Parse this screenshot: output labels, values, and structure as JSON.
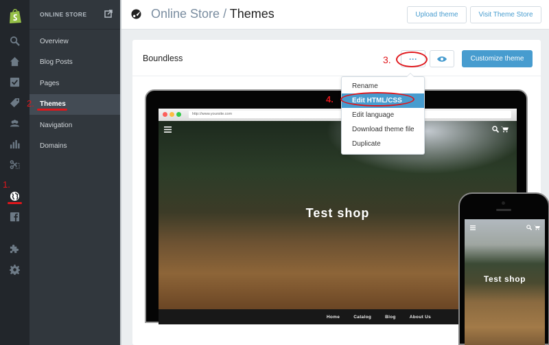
{
  "rail": {
    "icons": [
      "shopify-logo-icon",
      "search-icon",
      "home-icon",
      "orders-icon",
      "tag-icon",
      "customers-icon",
      "reports-icon",
      "discounts-icon",
      "online-store-icon",
      "facebook-icon",
      "apps-icon",
      "settings-icon"
    ],
    "brand_color": "#95bf47"
  },
  "subnav": {
    "header": "ONLINE STORE",
    "items": [
      {
        "label": "Overview"
      },
      {
        "label": "Blog Posts"
      },
      {
        "label": "Pages"
      },
      {
        "label": "Themes",
        "active": true
      },
      {
        "label": "Navigation"
      },
      {
        "label": "Domains"
      }
    ]
  },
  "header": {
    "breadcrumb": "Online Store",
    "separator": "/",
    "title": "Themes",
    "upload_label": "Upload theme",
    "visit_label": "Visit Theme Store"
  },
  "theme_card": {
    "name": "Boundless",
    "more_label": "···",
    "customize_label": "Customize theme",
    "accent": "#479ccf"
  },
  "dropdown": {
    "items": [
      {
        "label": "Rename"
      },
      {
        "label": "Edit HTML/CSS",
        "active": true
      },
      {
        "label": "Edit language"
      },
      {
        "label": "Download theme file"
      },
      {
        "label": "Duplicate"
      }
    ]
  },
  "preview": {
    "url": "http://www.yoursite.com",
    "shop_title": "Test shop",
    "nav": [
      "Home",
      "Catalog",
      "Blog",
      "About Us"
    ]
  },
  "annotations": {
    "step1": "1.",
    "step2": "2.",
    "step3": "3.",
    "step4": "4.",
    "color": "#e0161b"
  }
}
